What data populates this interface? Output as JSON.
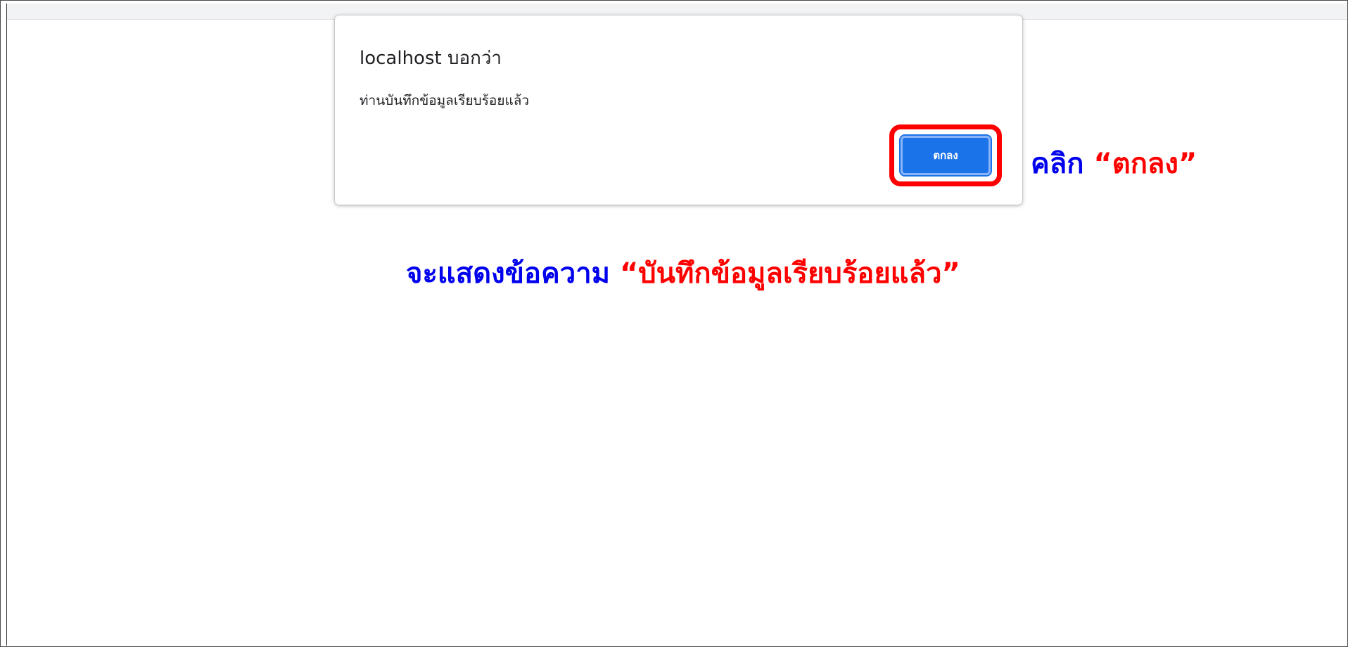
{
  "dialog": {
    "title": "localhost บอกว่า",
    "message": "ท่านบันทึกข้อมูลเรียบร้อยแล้ว",
    "ok_label": "ตกลง"
  },
  "annotations": {
    "click_prefix": "คลิก",
    "click_quoted": "“ตกลง”",
    "result_prefix": "จะแสดงข้อความ",
    "result_quoted": "“บันทึกข้อมูลเรียบร้อยแล้ว”"
  },
  "colors": {
    "annotation_blue": "#0000ee",
    "annotation_red": "#ff0000",
    "button_blue": "#1a73e8"
  }
}
